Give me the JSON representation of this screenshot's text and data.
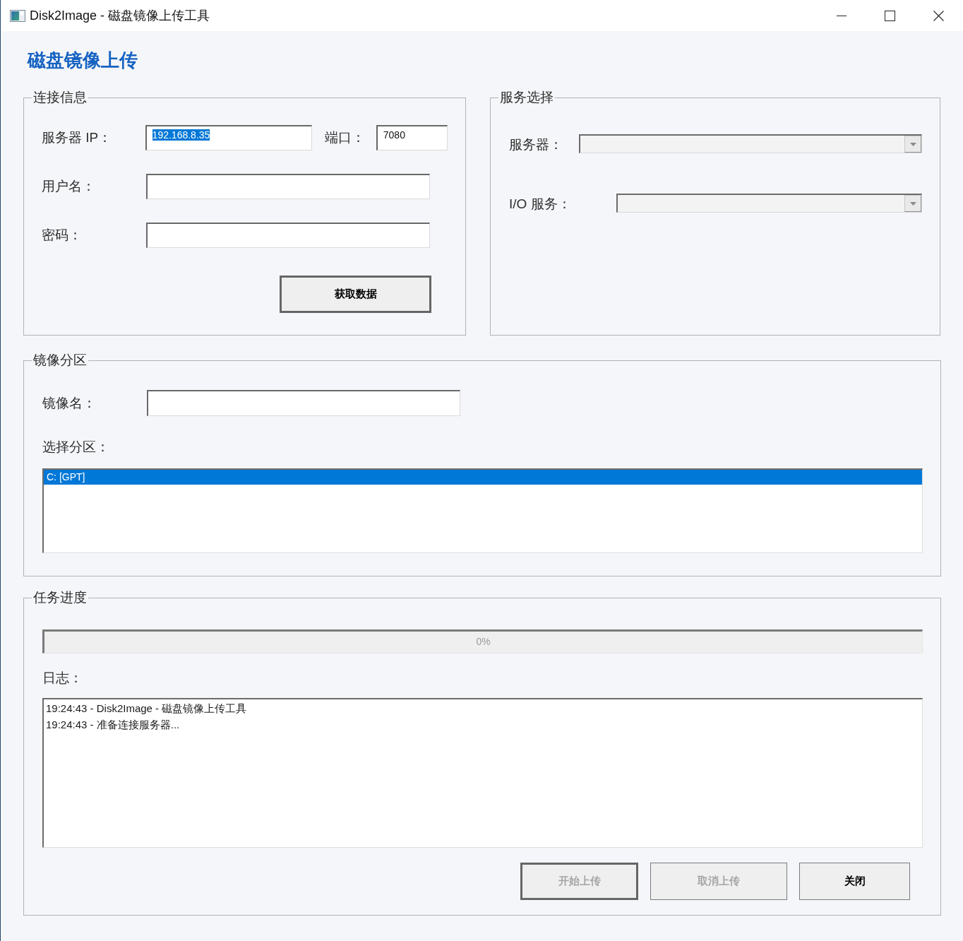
{
  "window": {
    "title": "Disk2Image - 磁盘镜像上传工具"
  },
  "heading": "磁盘镜像上传",
  "connection": {
    "title": "连接信息",
    "server_ip": {
      "label": "服务器 IP：",
      "value": "192.168.8.35",
      "value_selected": true
    },
    "port": {
      "label": "端口：",
      "value": "7080"
    },
    "username": {
      "label": "用户名："
    },
    "password": {
      "label": "密码："
    },
    "fetch_button": {
      "label": "获取数据",
      "default": true
    }
  },
  "service": {
    "title": "服务选择",
    "server": {
      "label": "服务器："
    },
    "io_service": {
      "label": "I/O 服务："
    }
  },
  "image": {
    "title": "镜像分区",
    "image_name": {
      "label": "镜像名："
    },
    "partition_label": "选择分区：",
    "partitions": [
      {
        "label": "C: [GPT]",
        "selected": true
      }
    ]
  },
  "progress": {
    "title": "任务进度",
    "percent_text": "0%",
    "log_label": "日志：",
    "log_lines": [
      "19:24:43 - Disk2Image - 磁盘镜像上传工具",
      "19:24:43 - 准备连接服务器..."
    ]
  },
  "buttons": [
    {
      "label": "开始上传",
      "disabled": true,
      "default": true
    },
    {
      "label": "取消上传",
      "disabled": true,
      "default": false
    },
    {
      "label": "关闭",
      "disabled": false,
      "default": false
    }
  ]
}
